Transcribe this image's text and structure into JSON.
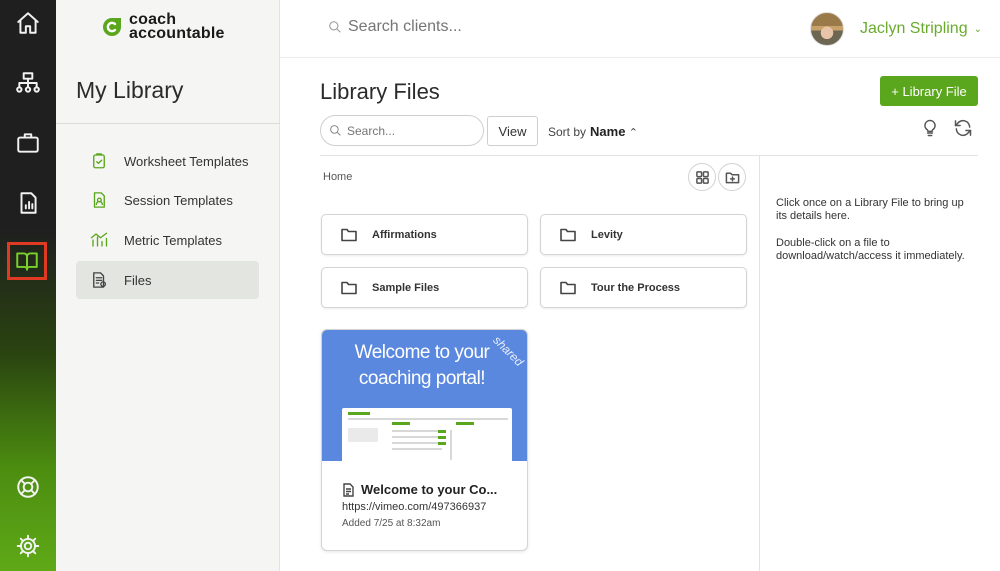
{
  "brand": {
    "logo_line1": "coach",
    "logo_line2": "accountable",
    "accent": "#5aa61c",
    "highlight": "#e13a23"
  },
  "rail": {
    "items": [
      {
        "name": "home-icon",
        "active": false
      },
      {
        "name": "org-chart-icon",
        "active": false
      },
      {
        "name": "briefcase-icon",
        "active": false
      },
      {
        "name": "report-icon",
        "active": false
      },
      {
        "name": "library-book-icon",
        "active": true
      },
      {
        "name": "help-lifebuoy-icon",
        "active": false
      },
      {
        "name": "settings-gear-icon",
        "active": false
      }
    ]
  },
  "sidebar": {
    "title": "My Library",
    "items": [
      {
        "label": "Worksheet Templates",
        "icon": "clipboard-check-icon",
        "active": false
      },
      {
        "label": "Session Templates",
        "icon": "session-doc-icon",
        "active": false
      },
      {
        "label": "Metric Templates",
        "icon": "metric-chart-icon",
        "active": false
      },
      {
        "label": "Files",
        "icon": "file-list-icon",
        "active": true
      }
    ]
  },
  "topbar": {
    "search_placeholder": "Search clients...",
    "user_name": "Jaclyn Stripling"
  },
  "main": {
    "title": "Library Files",
    "add_button": "+ Library File",
    "search_placeholder": "Search...",
    "view_button": "View",
    "sort_label": "Sort by",
    "sort_value": "Name",
    "breadcrumb": "Home",
    "folders": [
      "Affirmations",
      "Levity",
      "Sample Files",
      "Tour the Process"
    ],
    "file": {
      "thumb_title": "Welcome to your coaching portal!",
      "badge": "shared",
      "name": "Welcome to your Co...",
      "url": "https://vimeo.com/497366937",
      "added": "Added 7/25 at 8:32am"
    },
    "help": {
      "line1": "Click once on a Library File to bring up its details here.",
      "line2": "Double-click on a file to download/watch/access it immediately."
    }
  }
}
